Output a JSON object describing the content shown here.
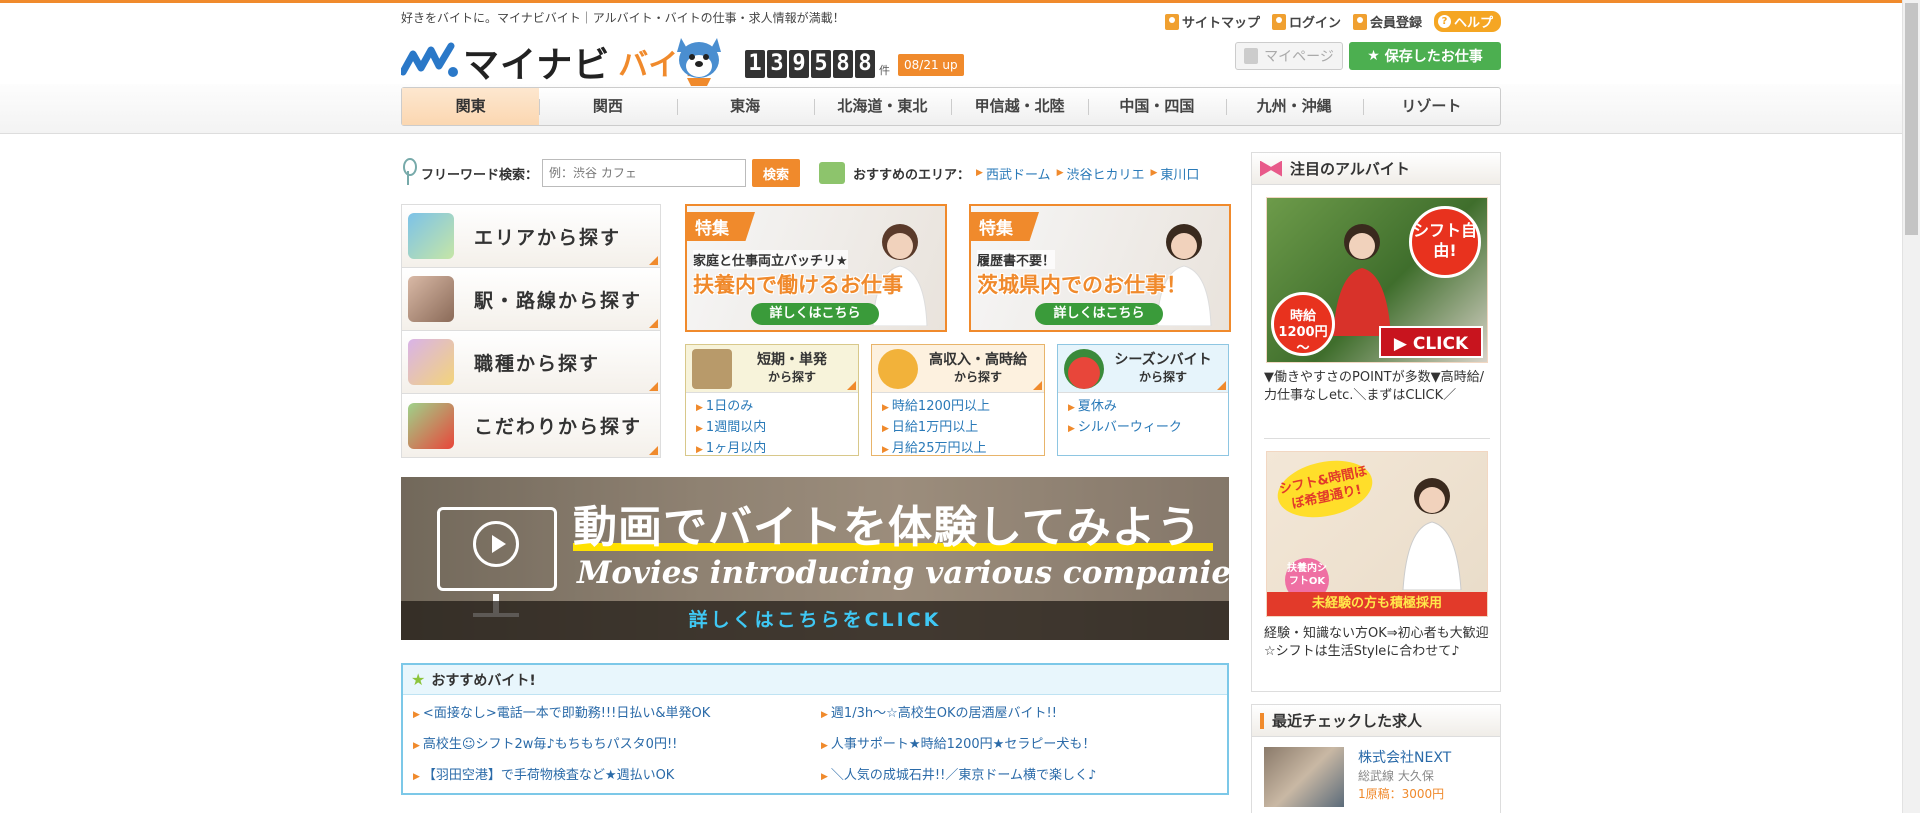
{
  "header": {
    "tagline": "好きをバイトに。マイナビバイト｜アルバイト・バイトの仕事・求人情報が満載！",
    "util": [
      "サイトマップ",
      "ログイン",
      "会員登録"
    ],
    "help": "ヘルプ",
    "logo_main": "マイナビ",
    "logo_sub": "バイト",
    "count_digits": [
      "1",
      "3",
      "9",
      "5",
      "8",
      "8"
    ],
    "count_unit": "件",
    "update_badge": "08/21 up",
    "mypage": "マイページ",
    "saved_jobs": "保存したお仕事"
  },
  "regions": [
    "関東",
    "関西",
    "東海",
    "北海道・東北",
    "甲信越・北陸",
    "中国・四国",
    "九州・沖縄",
    "リゾート"
  ],
  "search": {
    "label": "フリーワード検索：",
    "placeholder": "例：渋谷 カフェ",
    "button": "検索"
  },
  "recommended_area": {
    "label": "おすすめのエリア：",
    "links": [
      "西武ドーム",
      "渋谷ヒカリエ",
      "東川口"
    ]
  },
  "left_menu": [
    "エリアから探す",
    "駅・路線から探す",
    "職種から探す",
    "こだわりから探す"
  ],
  "features": [
    {
      "tag": "特集",
      "sub": "家庭と仕事両立バッチリ★",
      "main": "扶養内で働けるお仕事",
      "cta": "詳しくはこちら"
    },
    {
      "tag": "特集",
      "sub": "履歴書不要！",
      "main": "茨城県内でのお仕事！",
      "cta": "詳しくはこちら"
    }
  ],
  "search_boxes": [
    {
      "title": "短期・単発",
      "sub": "から探す",
      "links": [
        "1日のみ",
        "1週間以内",
        "1ヶ月以内"
      ],
      "color": "#f7f3da",
      "border": "#d8c88a"
    },
    {
      "title": "高収入・高時給",
      "sub": "から探す",
      "links": [
        "時給1200円以上",
        "日給1万円以上",
        "月給25万円以上"
      ],
      "color": "#fdf1df",
      "border": "#e8b46a"
    },
    {
      "title": "シーズンバイト",
      "sub": "から探す",
      "links": [
        "夏休み",
        "シルバーウィーク"
      ],
      "color": "#e6f4fb",
      "border": "#8ec6e2"
    }
  ],
  "banner": {
    "headline": "動画でバイトを体験してみよう",
    "english": "Movies introducing various companies",
    "cta": "詳しくはこちらをCLICK"
  },
  "recommended_jobs": {
    "title": "おすすめバイト!",
    "items": [
      "<面接なし>電話一本で即勤務!!!日払い&単発OK",
      "週1/3h～☆高校生OKの居酒屋バイト!!",
      "高校生☺シフト2w毎♪もちもちパスタ0円!!",
      "人事サポート★時給1200円★セラピー犬も！",
      "【羽田空港】で手荷物検査など★週払いOK",
      "＼人気の成城石井!!／東京ドーム横で楽しく♪"
    ]
  },
  "sidebar": {
    "featured_title": "注目のアルバイト",
    "ad1": {
      "badge_top": "シフト自由!",
      "badge_wage": "時給1200円～",
      "click": "CLICK",
      "text": "▼働きやすさのPOINTが多数▼高時給/力仕事なしetc.＼まずはCLICK／"
    },
    "ad2": {
      "tag1": "シフト&時間ほぼ希望通り!",
      "tag2": "扶養内シフトOK",
      "bottom": "未経験の方も積極採用",
      "text": "経験・知識ない方OK⇒初心者も大歓迎☆シフトは生活Styleに合わせて♪"
    },
    "recent_title": "最近チェックした求人",
    "recent": {
      "company": "株式会社NEXT",
      "line": "総武線 大久保",
      "pay": "1原稿：3000円"
    }
  }
}
